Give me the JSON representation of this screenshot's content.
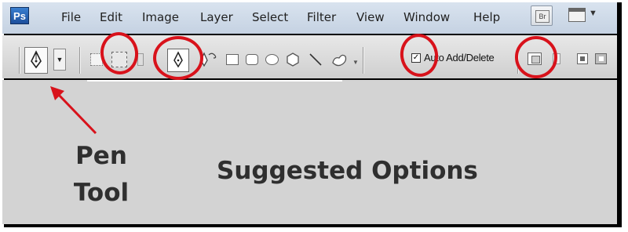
{
  "app": {
    "logo_text": "Ps"
  },
  "menu": [
    "File",
    "Edit",
    "Image",
    "Layer",
    "Select",
    "Filter",
    "View",
    "Window",
    "Help"
  ],
  "menubar_buttons": {
    "bridge_label": "Br"
  },
  "options_bar": {
    "auto_add_delete_label": "Auto Add/Delete",
    "auto_add_delete_checked": true
  },
  "annotations": {
    "pen_label_line1": "Pen",
    "pen_label_line2": "Tool",
    "suggested_label": "Suggested Options",
    "highlight_color": "#d8121b"
  },
  "colors": {
    "menubar_bg": "#cbd7e6",
    "content_bg": "#d3d3d3",
    "frame": "#000000"
  }
}
